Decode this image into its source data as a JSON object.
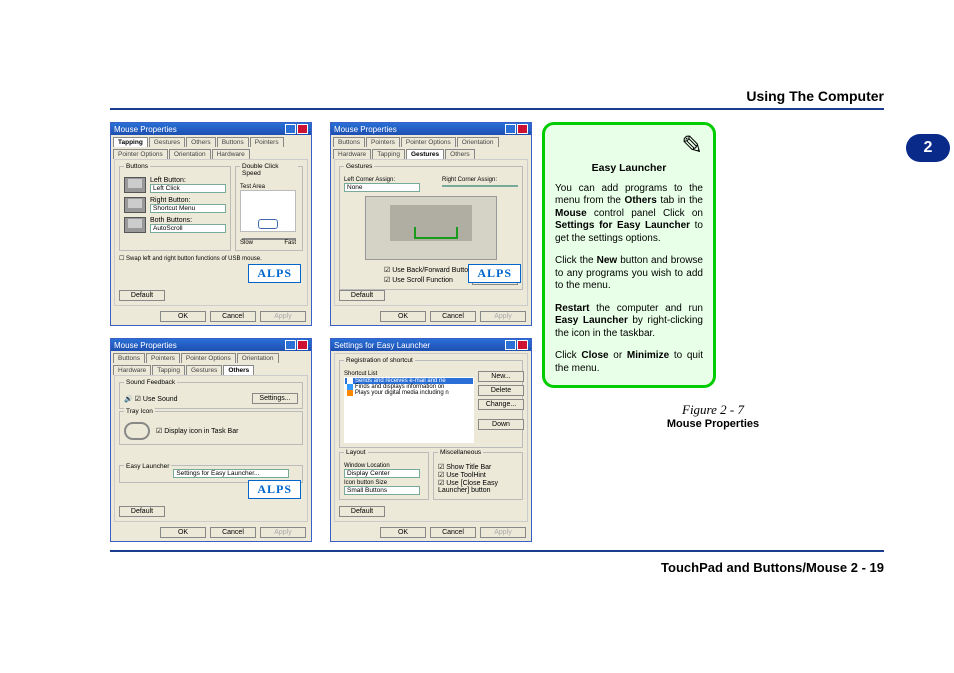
{
  "header": {
    "title": "Using The Computer",
    "chapter": "2"
  },
  "footer": {
    "text": "TouchPad and Buttons/Mouse  2  -  19"
  },
  "figure": {
    "num": "Figure 2 - 7",
    "title": "Mouse Properties"
  },
  "callout": {
    "pencil": "✎",
    "title": "Easy Launcher",
    "p1_a": "You can add programs to the menu from the ",
    "p1_b": "Others",
    "p1_c": " tab in the ",
    "p1_d": "Mouse",
    "p1_e": " control panel Click on ",
    "p1_f": "Settings for Easy Launcher",
    "p1_g": " to get the settings options.",
    "p2_a": "Click the ",
    "p2_b": "New",
    "p2_c": " button and browse to any programs you wish to add to the menu.",
    "p3_a": "Restart",
    "p3_b": " the computer and run ",
    "p3_c": "Easy Launcher",
    "p3_d": " by right-clicking the icon in the taskbar.",
    "p4_a": "Click ",
    "p4_b": "Close",
    "p4_c": " or ",
    "p4_d": "Minimize",
    "p4_e": " to quit the menu."
  },
  "common": {
    "mouse_title": "Mouse Properties",
    "ok": "OK",
    "cancel": "Cancel",
    "apply": "Apply",
    "default": "Default",
    "settings": "Settings...",
    "alps": "ALPS"
  },
  "tabs_row1": [
    "Buttons",
    "Pointers",
    "Pointer Options",
    "Orientation",
    "Hardware"
  ],
  "tabs_row2": [
    "Tapping",
    "Gestures",
    "Others"
  ],
  "dlg1": {
    "buttons_legend": "Buttons",
    "dbl_legend": "Double Click Speed",
    "test_area": "Test Area",
    "left_label": "Left Button:",
    "left_val": "Left Click",
    "right_label": "Right Button:",
    "right_val": "Shortcut Menu",
    "both_label": "Both Buttons:",
    "both_val": "AutoScroll",
    "swap": "Swap left and right button functions of USB mouse.",
    "slow": "Slow",
    "fast": "Fast"
  },
  "dlg2": {
    "gest_legend": "Gestures",
    "left_assign": "Left Corner Assign:",
    "left_v": "None",
    "right_assign": "Right Corner Assign:",
    "right_v": "",
    "useback": "Use Back/Forward Buttons",
    "usescroll": "Use Scroll Function"
  },
  "dlg3": {
    "sound_legend": "Sound Feedback",
    "use_sound": "Use Sound",
    "tray_legend": "Tray Icon",
    "tray_opt": "Display icon in Task Bar",
    "easy_legend": "Easy Launcher",
    "easy_link": "Settings for Easy Launcher..."
  },
  "dlg4": {
    "title": "Settings for Easy Launcher",
    "reg_legend": "Registration of shortcut",
    "list_label": "Shortcut List",
    "items": [
      {
        "txt": "Sends and receives e-mail and ne",
        "sel": true
      },
      {
        "txt": "Finds and displays information on",
        "sel": false
      },
      {
        "txt": "Plays your digital media including n",
        "sel": false
      }
    ],
    "new": "New...",
    "delete": "Delete",
    "change": "Change...",
    "down": "Down",
    "layout_legend": "Layout",
    "window_loc": "Window Location",
    "window_v": "Display Center",
    "icon_size": "Icon button Size",
    "icon_v": "Small Buttons",
    "misc_legend": "Miscellaneous",
    "show_title": "Show Title Bar",
    "use_toolt": "Use ToolHint",
    "use_close": "Use [Close Easy Launcher] button"
  }
}
